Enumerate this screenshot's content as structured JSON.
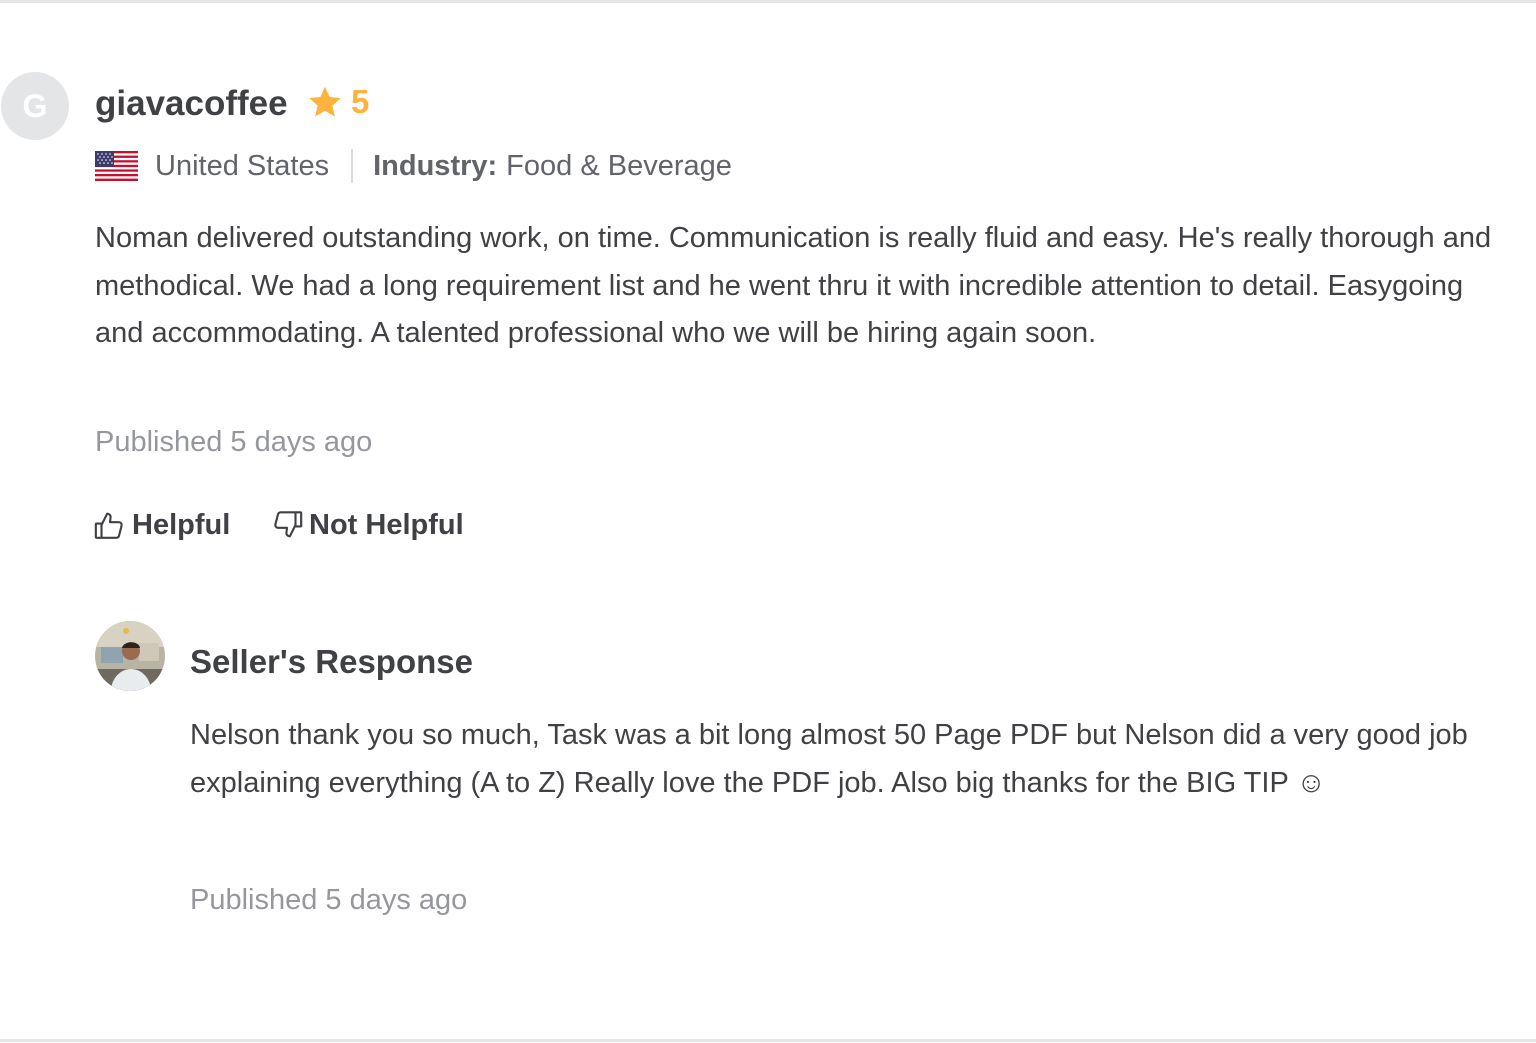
{
  "review": {
    "avatar_letter": "G",
    "username": "giavacoffee",
    "rating": "5",
    "country": "United States",
    "industry_label": "Industry:",
    "industry_value": "Food & Beverage",
    "text": "Noman delivered outstanding work, on time. Communication is really fluid and easy. He's really thorough and methodical. We had a long requirement list and he went thru it with incredible attention to detail. Easygoing and accommodating. A talented professional who we will be hiring again soon.",
    "published": "Published 5 days ago",
    "helpful_label": "Helpful",
    "not_helpful_label": "Not Helpful"
  },
  "seller_response": {
    "title": "Seller's Response",
    "text": "Nelson thank you so much, Task was a bit long almost 50 Page PDF but Nelson did a very good job explaining everything (A to Z) Really love the PDF job. Also big thanks for the BIG TIP ☺",
    "published": "Published 5 days ago"
  },
  "colors": {
    "star": "#ffb33e",
    "text": "#404145",
    "muted": "#62646a",
    "published": "#95979d",
    "avatar_bg": "#e4e5e7"
  },
  "icons": [
    "star-icon",
    "us-flag-icon",
    "thumbs-up-icon",
    "thumbs-down-icon"
  ]
}
